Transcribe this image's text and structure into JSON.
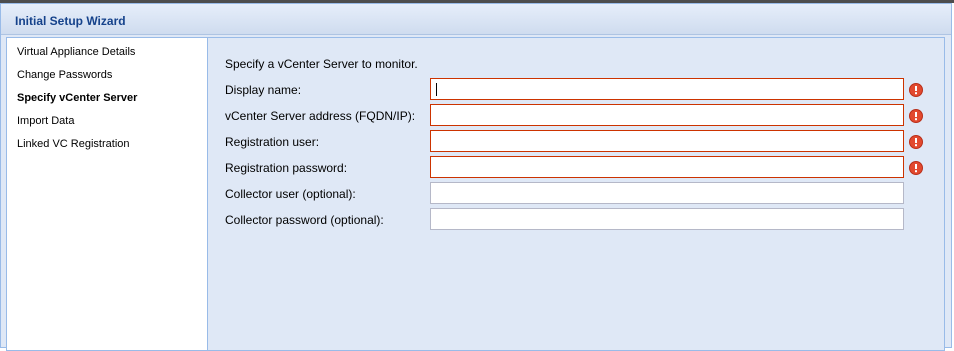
{
  "window": {
    "title": "Initial Setup Wizard"
  },
  "nav": {
    "items": [
      {
        "label": "Virtual Appliance Details",
        "active": false
      },
      {
        "label": "Change Passwords",
        "active": false
      },
      {
        "label": "Specify vCenter Server",
        "active": true
      },
      {
        "label": "Import Data",
        "active": false
      },
      {
        "label": "Linked VC Registration",
        "active": false
      }
    ]
  },
  "form": {
    "intro": "Specify a vCenter Server to monitor.",
    "fields": [
      {
        "label": "Display name:",
        "value": "",
        "required": true,
        "invalid": true
      },
      {
        "label": "vCenter Server address (FQDN/IP):",
        "value": "",
        "required": true,
        "invalid": true
      },
      {
        "label": "Registration user:",
        "value": "",
        "required": true,
        "invalid": true
      },
      {
        "label": "Registration password:",
        "value": "",
        "required": true,
        "invalid": true
      },
      {
        "label": "Collector user (optional):",
        "value": "",
        "required": false,
        "invalid": false
      },
      {
        "label": "Collector password (optional):",
        "value": "",
        "required": false,
        "invalid": false
      }
    ]
  },
  "colors": {
    "title_text": "#15428b",
    "error_border": "#cc3300",
    "error_icon": "#e2492f",
    "panel_bg": "#dfe8f6"
  },
  "icons": {
    "error": "exclamation-circle-icon"
  }
}
